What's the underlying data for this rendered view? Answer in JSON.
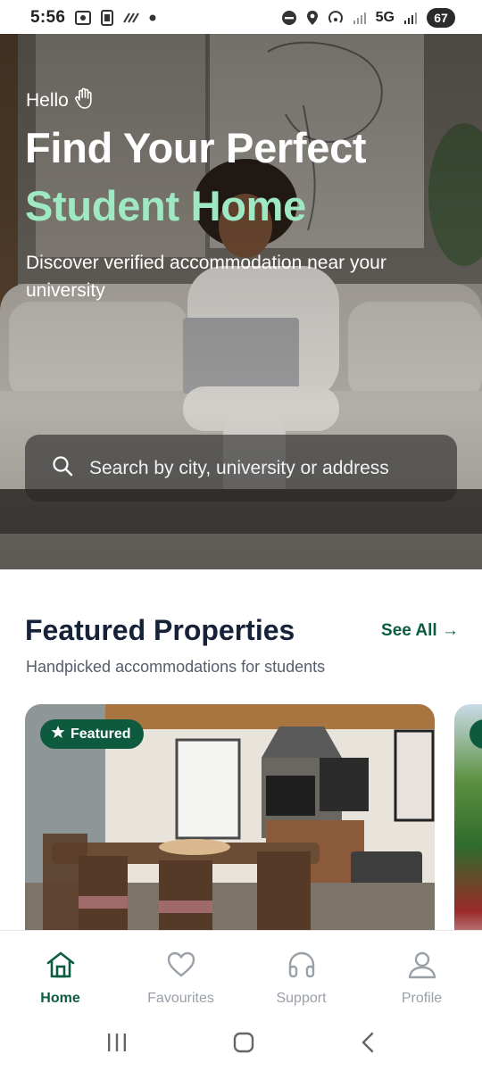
{
  "status_bar": {
    "time": "5:56",
    "network": "5G",
    "battery": "67"
  },
  "hero": {
    "greeting": "Hello",
    "title_line1": "Find Your Perfect",
    "title_line2": "Student Home",
    "subtitle": "Discover verified accommodation near your university",
    "search_placeholder": "Search by city, university or address",
    "accent_color": "#9ee8c3"
  },
  "featured": {
    "title": "Featured Properties",
    "see_all": "See All →",
    "subtitle": "Handpicked accommodations for students",
    "badge": "Featured"
  },
  "bottom_nav": {
    "items": [
      {
        "label": "Home",
        "icon": "home-icon",
        "active": true
      },
      {
        "label": "Favourites",
        "icon": "heart-icon",
        "active": false
      },
      {
        "label": "Support",
        "icon": "headphones-icon",
        "active": false
      },
      {
        "label": "Profile",
        "icon": "user-icon",
        "active": false
      }
    ]
  },
  "colors": {
    "brand_green": "#0b5c43",
    "badge_green": "#0d5a3f",
    "heading_navy": "#152238"
  }
}
